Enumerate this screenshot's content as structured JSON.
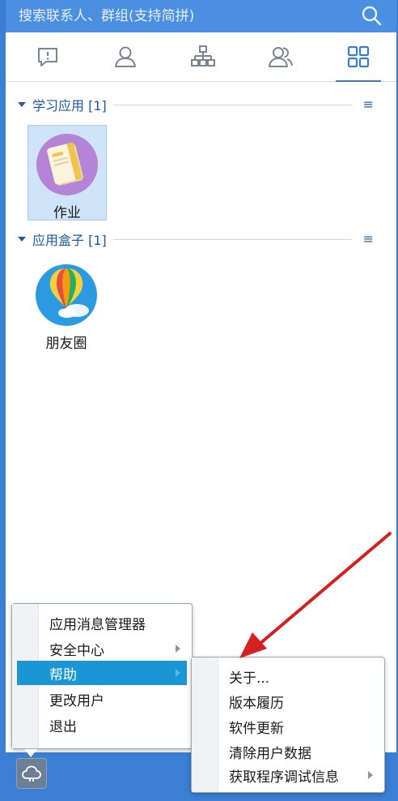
{
  "search": {
    "placeholder": "搜索联系人、群组(支持简拼)"
  },
  "tabs": [
    {
      "name": "messages",
      "icon": "chat-bubble-icon"
    },
    {
      "name": "contacts",
      "icon": "person-icon"
    },
    {
      "name": "organization",
      "icon": "org-chart-icon"
    },
    {
      "name": "groups",
      "icon": "group-icon"
    },
    {
      "name": "apps",
      "icon": "grid-icon",
      "active": true
    }
  ],
  "groups": [
    {
      "title": "学习应用 [1]",
      "apps": [
        {
          "label": "作业",
          "icon": "homework-icon",
          "selected": true
        }
      ]
    },
    {
      "title": "应用盒子 [1]",
      "apps": [
        {
          "label": "朋友圈",
          "icon": "hot-air-balloon-icon"
        }
      ]
    }
  ],
  "group_menu_glyph": "≡",
  "main_menu": {
    "items": [
      {
        "label": "应用消息管理器"
      },
      {
        "label": "安全中心",
        "submenu": true
      },
      {
        "label": "帮助",
        "submenu": true,
        "highlighted": true
      },
      {
        "label": "更改用户"
      },
      {
        "label": "退出"
      }
    ]
  },
  "help_submenu": {
    "items": [
      {
        "label": "关于..."
      },
      {
        "label": "版本履历"
      },
      {
        "label": "软件更新"
      },
      {
        "label": "清除用户数据"
      },
      {
        "label": "获取程序调试信息",
        "submenu": true
      }
    ]
  },
  "colors": {
    "accent": "#3b7fd4",
    "highlight": "#1a96d4",
    "annotation_arrow": "#d42020"
  }
}
